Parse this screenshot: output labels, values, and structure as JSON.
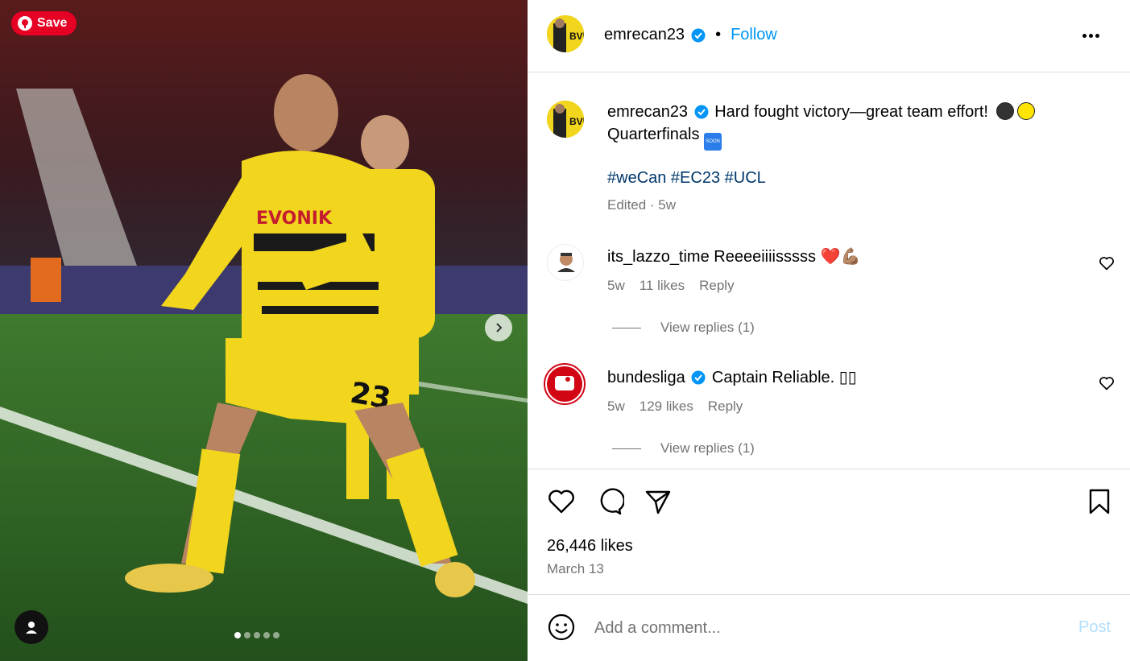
{
  "media": {
    "save_label": "Save",
    "carousel_count": 5,
    "carousel_active": 1,
    "icons": {
      "pin": "pinterest-icon",
      "next": "chevron-right-icon",
      "tag": "user-tag-icon"
    },
    "jersey": {
      "sponsor": "EVONIK",
      "number": "23"
    }
  },
  "header": {
    "username": "emrecan23",
    "verified": true,
    "follow_label": "Follow",
    "bullet": "•"
  },
  "caption": {
    "username": "emrecan23",
    "text": "Hard fought victory—great team effort!",
    "text2": "Quarterfinals",
    "hashtags": "#weCan #EC23 #UCL",
    "meta": "Edited · 5w",
    "soon_badge": "SOON"
  },
  "comments": [
    {
      "username": "its_lazzo_time",
      "text": "Reeeeiiiisssss ❤️💪🏽",
      "time": "5w",
      "likes": "11 likes",
      "reply_label": "Reply",
      "view_replies": "View replies (1)"
    },
    {
      "username": "bundesliga",
      "verified": true,
      "text": "Captain Reliable. ▯▯",
      "time": "5w",
      "likes": "129 likes",
      "reply_label": "Reply",
      "view_replies": "View replies (1)"
    }
  ],
  "actions": {
    "likes": "26,446 likes",
    "date": "March 13"
  },
  "add_comment": {
    "placeholder": "Add a comment...",
    "post_label": "Post"
  },
  "colors": {
    "accent": "#0095f6",
    "pinterest": "#e60023",
    "muted": "#737373",
    "hashtag": "#00376b",
    "bvb_yellow": "#f2d51d"
  }
}
